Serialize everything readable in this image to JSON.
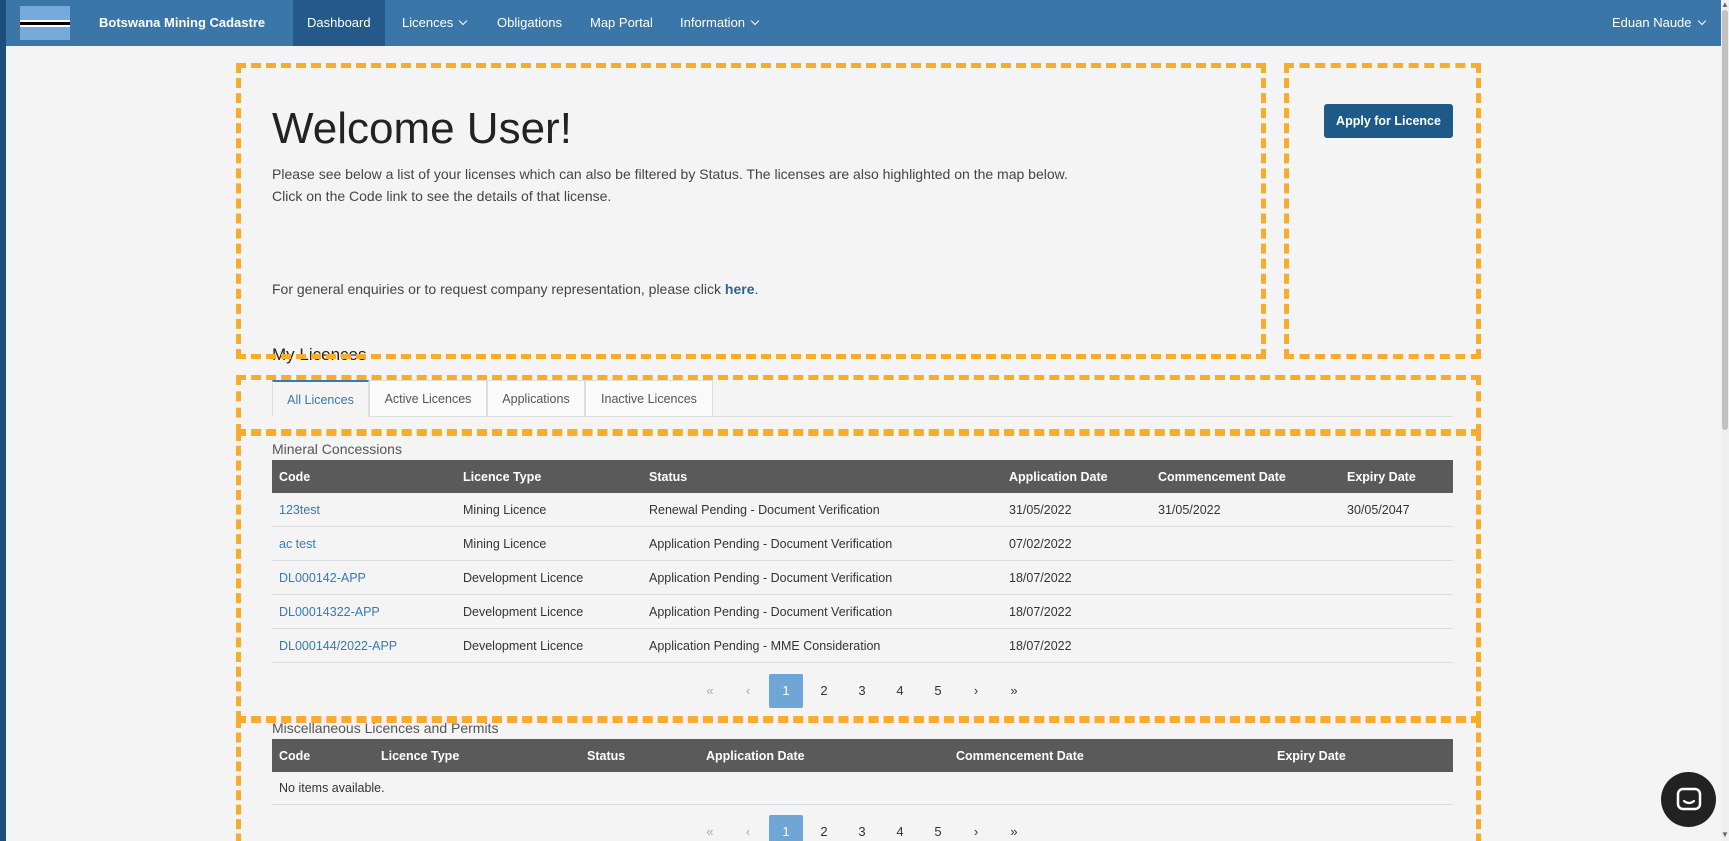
{
  "navbar": {
    "brand": "Botswana Mining Cadastre",
    "items": [
      {
        "label": "Dashboard"
      },
      {
        "label": "Licences"
      },
      {
        "label": "Obligations"
      },
      {
        "label": "Map Portal"
      },
      {
        "label": "Information"
      }
    ],
    "user": "Eduan Naude"
  },
  "welcome": {
    "title": "Welcome User!",
    "line1": "Please see below a list of your licenses which can also be filtered by Status. The licenses are also highlighted on the map below.",
    "line2": "Click on the Code link to see the details of that license.",
    "enquiry_prefix": "For general enquiries or to request company representation, please click ",
    "enquiry_link": "here",
    "enquiry_suffix": "."
  },
  "apply_button": "Apply for Licence",
  "my_licences": {
    "heading": "My Licences",
    "tabs": [
      "All Licences",
      "Active Licences",
      "Applications",
      "Inactive Licences"
    ]
  },
  "mineral": {
    "label": "Mineral Concessions",
    "columns": [
      "Code",
      "Licence Type",
      "Status",
      "Application Date",
      "Commencement Date",
      "Expiry Date"
    ],
    "rows": [
      [
        "123test",
        "Mining Licence",
        "Renewal Pending - Document Verification",
        "31/05/2022",
        "31/05/2022",
        "30/05/2047"
      ],
      [
        "ac test",
        "Mining Licence",
        "Application Pending - Document Verification",
        "07/02/2022",
        "",
        ""
      ],
      [
        "DL000142-APP",
        "Development Licence",
        "Application Pending - Document Verification",
        "18/07/2022",
        "",
        ""
      ],
      [
        "DL00014322-APP",
        "Development Licence",
        "Application Pending - Document Verification",
        "18/07/2022",
        "",
        ""
      ],
      [
        "DL000144/2022-APP",
        "Development Licence",
        "Application Pending - MME Consideration",
        "18/07/2022",
        "",
        ""
      ]
    ]
  },
  "misc": {
    "label": "Miscellaneous Licences and Permits",
    "columns": [
      "Code",
      "Licence Type",
      "Status",
      "Application Date",
      "Commencement Date",
      "Expiry Date"
    ],
    "empty": "No items available."
  },
  "pager": {
    "first": "«",
    "prev": "‹",
    "pages": [
      "1",
      "2",
      "3",
      "4",
      "5"
    ],
    "next": "›",
    "last": "»",
    "current": "1"
  },
  "colors": {
    "navbar": "#3a76a8",
    "navbar_active": "#24598a",
    "accent_button": "#1d5a8a",
    "table_header": "#5a5a5a",
    "highlight_dash": "#f7ac2b",
    "page_active": "#6fa6d6"
  },
  "icons": {
    "chat": "chat-bubble-icon",
    "chevron": "chevron-down-icon"
  }
}
